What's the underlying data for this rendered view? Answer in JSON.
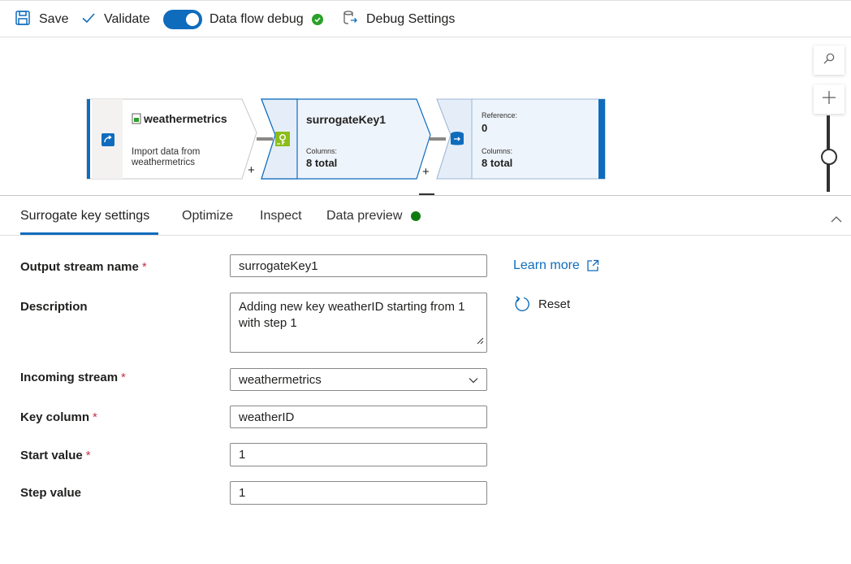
{
  "toolbar": {
    "save_label": "Save",
    "validate_label": "Validate",
    "debug_toggle_label": "Data flow debug",
    "debug_toggle_on": true,
    "debug_settings_label": "Debug Settings"
  },
  "canvas": {
    "nodes": [
      {
        "title": "weathermetrics",
        "subtitle": "Import data from weathermetrics"
      },
      {
        "title": "surrogateKey1",
        "columns_label": "Columns:",
        "columns_value": "8 total"
      },
      {
        "reference_label": "Reference:",
        "reference_value": "0",
        "columns_label": "Columns:",
        "columns_value": "8 total"
      }
    ],
    "add_glyph": "+"
  },
  "tabs": [
    {
      "label": "Surrogate key settings",
      "active": true
    },
    {
      "label": "Optimize"
    },
    {
      "label": "Inspect"
    },
    {
      "label": "Data preview"
    }
  ],
  "form": {
    "output_stream_name": {
      "label": "Output stream name",
      "required": "*",
      "value": "surrogateKey1"
    },
    "description": {
      "label": "Description",
      "value": "Adding new key weatherID starting from 1 with step 1"
    },
    "incoming_stream": {
      "label": "Incoming stream",
      "required": "*",
      "value": "weathermetrics"
    },
    "key_column": {
      "label": "Key column",
      "required": "*",
      "value": "weatherID"
    },
    "start_value": {
      "label": "Start value",
      "required": "*",
      "value": "1"
    },
    "step_value": {
      "label": "Step value",
      "value": "1"
    }
  },
  "side": {
    "learn_more": "Learn more",
    "reset": "Reset"
  },
  "colors": {
    "accent": "#0f6cbd",
    "success": "#2aa12a",
    "required": "#c4314b"
  }
}
